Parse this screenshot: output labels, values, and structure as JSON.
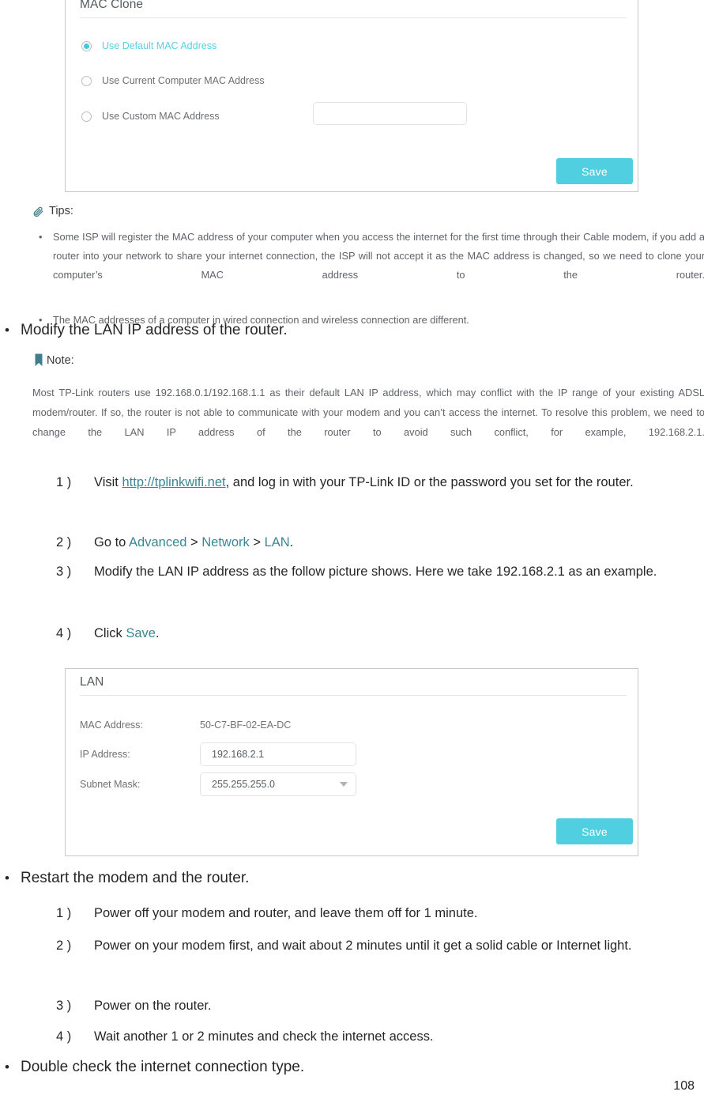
{
  "mac_clone_panel": {
    "title": "MAC Clone",
    "options": [
      {
        "label": "Use Default MAC Address",
        "selected": true
      },
      {
        "label": "Use Current Computer MAC Address",
        "selected": false
      },
      {
        "label": "Use Custom MAC Address",
        "selected": false
      }
    ],
    "custom_mac_value": "",
    "custom_mac_placeholder": "",
    "save_label": "Save"
  },
  "tips": {
    "icon": "paperclip-icon",
    "heading": "Tips:",
    "bullet_char": "•",
    "items": [
      "Some ISP will register the MAC address of your computer when you access the internet for the first time through their Cable modem, if you add a router into your network to share your internet connection, the ISP will not accept it as the MAC address is changed, so we need to clone your computer’s MAC address to the router.",
      "The MAC addresses of a computer in wired connection and wireless connection are different."
    ]
  },
  "bullet_modify_lan": {
    "dot": "•",
    "text": "Modify the LAN IP address of the router."
  },
  "note": {
    "icon": "bookmark-icon",
    "heading": "Note:",
    "body": "Most TP-Link routers use 192.168.0.1/192.168.1.1 as their default LAN IP address, which may conflict with the IP range of your existing ADSL modem/router. If so, the router is not able to communicate with your modem and you can’t access the internet. To resolve this problem, we need to change the LAN IP address of the router to avoid such conflict, for example, 192.168.2.1."
  },
  "steps_lan": [
    {
      "num": "1 )",
      "pre": "Visit ",
      "link": "http://tplinkwifi.net",
      "post": ", and log in with your TP-Link ID or the password you set for the router."
    },
    {
      "num": "2 )",
      "pre": "Go to ",
      "link1": "Advanced",
      "sep1": " > ",
      "link2": "Network",
      "sep2": " > ",
      "link3": "LAN",
      "post": "."
    },
    {
      "num": "3 )",
      "text": "Modify the LAN IP address as the follow picture shows. Here we take 192.168.2.1 as an example."
    },
    {
      "num": "4 )",
      "pre": "Click ",
      "link": "Save",
      "post": "."
    }
  ],
  "lan_panel": {
    "title": "LAN",
    "fields": [
      {
        "label": "MAC Address:",
        "value": "50-C7-BF-02-EA-DC",
        "type": "static"
      },
      {
        "label": "IP Address:",
        "value": "192.168.2.1",
        "type": "input"
      },
      {
        "label": "Subnet Mask:",
        "value": "255.255.255.0",
        "type": "select"
      }
    ],
    "save_label": "Save"
  },
  "bullet_restart": {
    "dot": "•",
    "text": "Restart the modem and the router."
  },
  "steps_restart": [
    {
      "num": "1 )",
      "text": "Power off your modem and router, and leave them off for 1 minute."
    },
    {
      "num": "2 )",
      "text": "Power on your modem first, and wait about 2 minutes until it get a solid cable or Internet light."
    },
    {
      "num": "3 )",
      "text": "Power on the router."
    },
    {
      "num": "4 )",
      "text": "Wait another 1 or 2 minutes and check the internet access."
    }
  ],
  "bullet_double_check": {
    "dot": "•",
    "text": "Double check the internet connection type."
  },
  "page_number": "108",
  "colors": {
    "accent_button": "#4fcfdf",
    "accent_radio": "#3fcbdd",
    "link_teal": "#3d8593",
    "panel_border": "#c9c9c9"
  }
}
